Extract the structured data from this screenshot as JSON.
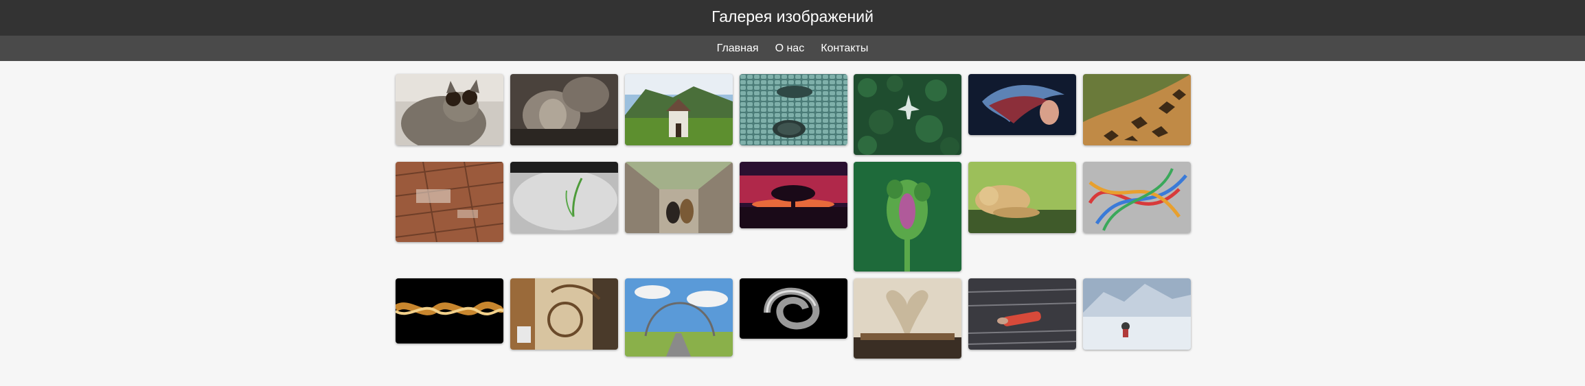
{
  "header": {
    "title": "Галерея изображений"
  },
  "nav": {
    "items": [
      {
        "label": "Главная"
      },
      {
        "label": "О нас"
      },
      {
        "label": "Контакты"
      }
    ]
  },
  "gallery": {
    "images": [
      {
        "subject": "cat with sunglasses",
        "colors": [
          "#c9c4bd",
          "#6f6a63",
          "#3a2a1e"
        ]
      },
      {
        "subject": "sculpture faces",
        "colors": [
          "#5e544c",
          "#8f857a",
          "#2b2622"
        ]
      },
      {
        "subject": "chapel in mountains",
        "colors": [
          "#8bb2d6",
          "#4f7d2f",
          "#e8e4da"
        ]
      },
      {
        "subject": "cobblestone manhole",
        "colors": [
          "#5a8e8a",
          "#8bbbb5",
          "#2f4845"
        ]
      },
      {
        "subject": "aerial forest airplane",
        "colors": [
          "#1f4d2f",
          "#2e6b3f",
          "#d9e4e0"
        ]
      },
      {
        "subject": "surreal portrait",
        "colors": [
          "#101a2f",
          "#8c2f3a",
          "#5d83b5"
        ]
      },
      {
        "subject": "giraffe pattern",
        "colors": [
          "#6a7a3a",
          "#c08a46",
          "#3d2a16"
        ]
      },
      {
        "subject": "brick pavement",
        "colors": [
          "#9b5a3c",
          "#c88a67",
          "#e2d6c9"
        ]
      },
      {
        "subject": "sprout in snow",
        "colors": [
          "#d8d8d8",
          "#8a8a8a",
          "#4d9b3a"
        ]
      },
      {
        "subject": "dogs on bridge",
        "colors": [
          "#8c8070",
          "#5a4e40",
          "#a3b08a"
        ]
      },
      {
        "subject": "tree at sunset",
        "colors": [
          "#2a1030",
          "#b0284a",
          "#e76a3b"
        ]
      },
      {
        "subject": "poppy bud",
        "colors": [
          "#1e6a3a",
          "#5aa84a",
          "#b05a9a"
        ]
      },
      {
        "subject": "puppy on grass",
        "colors": [
          "#9cbf5a",
          "#d8b47a",
          "#3f5a2a"
        ]
      },
      {
        "subject": "colored ropes",
        "colors": [
          "#b8b8b8",
          "#d83a3a",
          "#3a7ad8"
        ]
      },
      {
        "subject": "twisted golden light",
        "colors": [
          "#000000",
          "#c8862e",
          "#f2d08a"
        ]
      },
      {
        "subject": "ornate door sign",
        "colors": [
          "#9a6a3a",
          "#d8c4a0",
          "#4a3a2a"
        ]
      },
      {
        "subject": "arch landscape",
        "colors": [
          "#5a9ad8",
          "#8ab04a",
          "#f2f2f2"
        ]
      },
      {
        "subject": "chrome knot",
        "colors": [
          "#000000",
          "#9a9a9a",
          "#e0e0e0"
        ]
      },
      {
        "subject": "book heart pages",
        "colors": [
          "#3a2e24",
          "#e0d6c4",
          "#7a5a3a"
        ]
      },
      {
        "subject": "person on float in water",
        "colors": [
          "#3a3a40",
          "#7a7a80",
          "#d84a3a"
        ]
      },
      {
        "subject": "snowy mountain hiker",
        "colors": [
          "#d8e0ea",
          "#9aaec4",
          "#3a3a3a"
        ]
      }
    ]
  }
}
